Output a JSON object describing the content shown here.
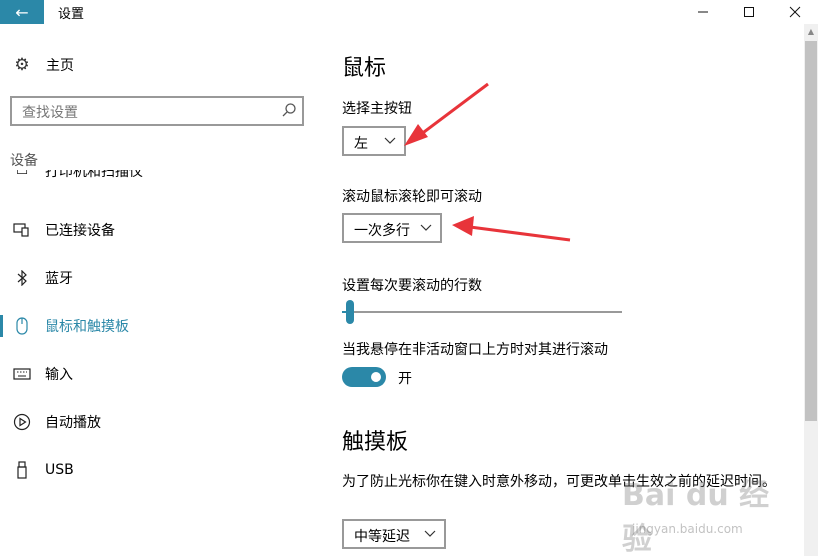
{
  "window": {
    "title": "设置",
    "back_glyph": "←",
    "minimize_glyph": "—",
    "maximize_glyph": "☐",
    "close_glyph": "✕",
    "accent_color": "#2b88a8"
  },
  "sidebar": {
    "home_label": "主页",
    "search_placeholder": "查找设置",
    "section_header": "设备",
    "items": [
      {
        "label": "打印机和扫描仪",
        "icon": "printer-icon"
      },
      {
        "label": "已连接设备",
        "icon": "devices-icon"
      },
      {
        "label": "蓝牙",
        "icon": "bluetooth-icon"
      },
      {
        "label": "鼠标和触摸板",
        "icon": "mouse-icon",
        "active": true
      },
      {
        "label": "输入",
        "icon": "keyboard-icon"
      },
      {
        "label": "自动播放",
        "icon": "autoplay-icon"
      },
      {
        "label": "USB",
        "icon": "usb-icon"
      }
    ]
  },
  "main": {
    "mouse_heading": "鼠标",
    "primary_button_label": "选择主按钮",
    "primary_button_value": "左",
    "scroll_mode_label": "滚动鼠标滚轮即可滚动",
    "scroll_mode_value": "一次多行",
    "lines_label": "设置每次要滚动的行数",
    "lines_level": 0.03,
    "inactive_scroll_label": "当我悬停在非活动窗口上方时对其进行滚动",
    "inactive_scroll_state": "开",
    "touchpad_heading": "触摸板",
    "touchpad_desc": "为了防止光标你在键入时意外移动，可更改单击生效之前的延迟时间。",
    "touchpad_delay_value": "中等延迟"
  },
  "watermark": {
    "logo": "Bai du 经验",
    "url": "jingyan.baidu.com"
  },
  "annotation_color": "#e8343a"
}
